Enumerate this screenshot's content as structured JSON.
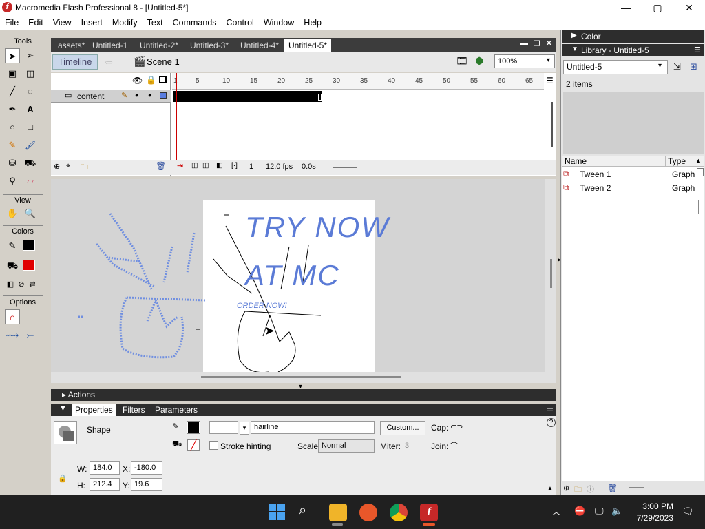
{
  "window": {
    "title": "Macromedia Flash Professional 8 - [Untitled-5*]",
    "app_letter": "f",
    "min": "—",
    "max": "▢",
    "close": "✕"
  },
  "menu": [
    "File",
    "Edit",
    "View",
    "Insert",
    "Modify",
    "Text",
    "Commands",
    "Control",
    "Window",
    "Help"
  ],
  "tools": {
    "title": "Tools",
    "view": "View",
    "colors": "Colors",
    "options": "Options"
  },
  "doc_tabs": [
    "assets*",
    "Untitled-1",
    "Untitled-2*",
    "Untitled-3*",
    "Untitled-4*",
    "Untitled-5*"
  ],
  "editbar": {
    "timeline": "Timeline",
    "scene": "Scene 1",
    "zoom": "100%"
  },
  "timeline": {
    "layer_name": "content",
    "ruler": [
      "1",
      "5",
      "10",
      "15",
      "20",
      "25",
      "30",
      "35",
      "40",
      "45",
      "50",
      "55",
      "60",
      "65"
    ],
    "frame": "1",
    "fps": "12.0 fps",
    "time": "0.0s"
  },
  "stage": {
    "line1": "TRY NOW",
    "line2": "AT MC",
    "line3": "ORDER NOW!"
  },
  "panels": {
    "actions": "Actions",
    "tabs": [
      "Properties",
      "Filters",
      "Parameters"
    ]
  },
  "props": {
    "type": "Shape",
    "stroke_style": "hairline",
    "custom": "Custom...",
    "cap": "Cap:",
    "stroke_hinting": "Stroke hinting",
    "scale_label": "Scale:",
    "scale_value": "Normal",
    "miter_label": "Miter:",
    "miter_value": "3",
    "join": "Join:",
    "w_label": "W:",
    "w": "184.0",
    "x_label": "X:",
    "x": "-180.0",
    "h_label": "H:",
    "h": "212.4",
    "y_label": "Y:",
    "y": "19.6"
  },
  "right": {
    "color_title": "Color",
    "library_title": "Library - Untitled-5",
    "library_select": "Untitled-5",
    "items_count": "2 items",
    "col_name": "Name",
    "col_type": "Type",
    "items": [
      {
        "name": "Tween 1",
        "type": "Graph"
      },
      {
        "name": "Tween 2",
        "type": "Graph"
      }
    ]
  },
  "taskbar": {
    "time": "3:00 PM",
    "date": "7/29/2023"
  },
  "colors": {
    "accent": "#c62828",
    "stage_text": "#5b7bd6"
  }
}
